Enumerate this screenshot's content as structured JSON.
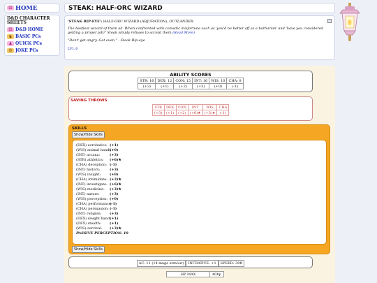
{
  "sidebar": {
    "home_label": "HOME",
    "section_title": "D&D CHARACTER SHEETS",
    "items": [
      {
        "label": "D&D HOME",
        "icon": "dice-icon"
      },
      {
        "label": "BASIC PCs",
        "icon": "hero-icon"
      },
      {
        "label": "QUICK PCs",
        "icon": "rogue-icon"
      },
      {
        "label": "JOKE PCs",
        "icon": "jester-icon"
      }
    ]
  },
  "page": {
    "title": "STEAK: HALF-ORC WIZARD"
  },
  "description": {
    "name": "'STEAK RIP-EYE':",
    "class": "HALF-ORC WIZARD (ABJURATION),",
    "background": "OUTLANDER",
    "blurb": "The beefiest wizard of them all. When confronted with comedic misfortune such as 'you'd be better off as a barbarian' and 'have you considered getting a proper job?' Steak simply refuses to accept them",
    "read_more": "(Read More)",
    "quote": "\"Don't get angry. Get even.\" - Steak Rip-eye",
    "level_link": "LVL 6"
  },
  "abilities": {
    "title": "ABILITY SCORES",
    "scores": [
      "STR: 16",
      "DEX: 12",
      "CON: 15",
      "INT: 16",
      "WIS: 10",
      "CHA: 8"
    ],
    "mods": [
      "(+3)",
      "(+1)",
      "(+2)",
      "(+3)",
      "(+0)",
      "(-1)"
    ]
  },
  "saves": {
    "title": "SAVING THROWS",
    "labels": [
      "STR",
      "DEX",
      "CON",
      "INT",
      "WIS",
      "CHA"
    ],
    "values": [
      "(+3)",
      "(+1)",
      "(+2)",
      "(+6)★",
      "(+3)★",
      "(-1)"
    ]
  },
  "skills": {
    "title": "SKILLS",
    "toggle_label": "Show/Hide Skills",
    "list": [
      {
        "name": "(DEX) acrobatics:",
        "value": "(+1)"
      },
      {
        "name": "(WIS) animal handl.:",
        "value": "(+0)"
      },
      {
        "name": "(INT) arcana:",
        "value": "(+3)"
      },
      {
        "name": "(STR) athletics:",
        "value": "(+6)★"
      },
      {
        "name": "(CHA) deception:",
        "value": "(-1)"
      },
      {
        "name": "(INT) history:",
        "value": "(+3)"
      },
      {
        "name": "(WIS) insight:",
        "value": "(+0)"
      },
      {
        "name": "(CHA) intimidate:",
        "value": "(+2)★"
      },
      {
        "name": "(INT) investigate:",
        "value": "(+6)★"
      },
      {
        "name": "(WIS) medicine:",
        "value": "(+3)★"
      },
      {
        "name": "(INT) nature:",
        "value": "(+3)"
      },
      {
        "name": "(WIS) perception:",
        "value": "(+0)"
      },
      {
        "name": "(CHA) performance:",
        "value": "(-1)"
      },
      {
        "name": "(CHA) persuasion:",
        "value": "(-1)"
      },
      {
        "name": "(INT) religion:",
        "value": "(+3)"
      },
      {
        "name": "(DEX) sleight hand:",
        "value": "(+1)"
      },
      {
        "name": "(DEX) stealth:",
        "value": "(+1)"
      },
      {
        "name": "(WIS) survival:",
        "value": "(+3)★"
      }
    ],
    "passive": "PASSIVE PERCEPTION: 10"
  },
  "combat": {
    "ac": "AC: 11 (14 mage armour)",
    "initiative": "INITIATIVE: +1",
    "speed": "SPEED: 30ft"
  },
  "hp": {
    "label": "HP MAX",
    "value": "40hp"
  }
}
